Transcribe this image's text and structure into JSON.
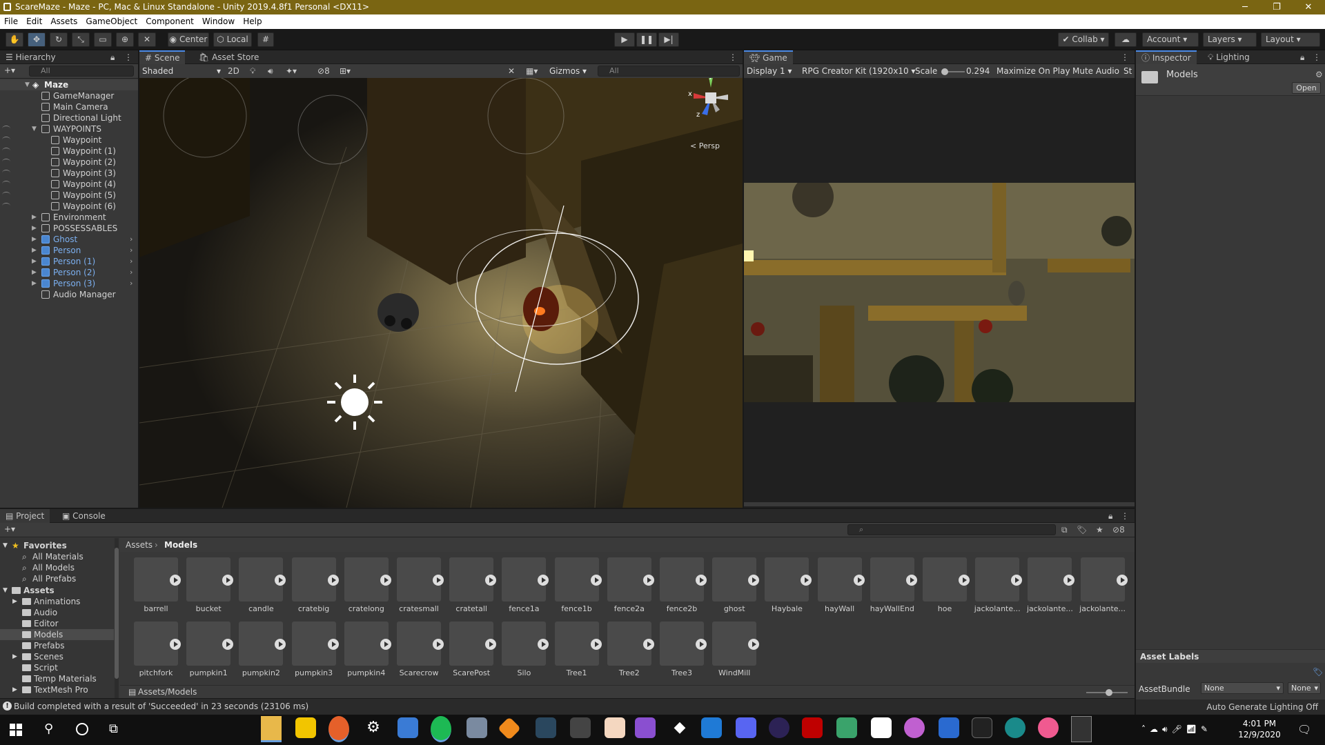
{
  "window": {
    "title": "ScareMaze - Maze - PC, Mac & Linux Standalone - Unity 2019.4.8f1 Personal <DX11>",
    "min": "─",
    "restore": "❐",
    "close": "✕"
  },
  "menu": [
    "File",
    "Edit",
    "Assets",
    "GameObject",
    "Component",
    "Window",
    "Help"
  ],
  "toolbar": {
    "pivot": "Center",
    "space": "Local",
    "collab": "Collab",
    "account": "Account",
    "layers": "Layers",
    "layout": "Layout"
  },
  "hierarchy": {
    "tab": "Hierarchy",
    "search_placeholder": "All",
    "scene": "Maze",
    "items": [
      {
        "label": "GameManager",
        "depth": 1,
        "blue": false,
        "arrow": ""
      },
      {
        "label": "Main Camera",
        "depth": 1,
        "blue": false,
        "arrow": ""
      },
      {
        "label": "Directional Light",
        "depth": 1,
        "blue": false,
        "arrow": ""
      },
      {
        "label": "WAYPOINTS",
        "depth": 1,
        "blue": false,
        "arrow": "▼"
      },
      {
        "label": "Waypoint",
        "depth": 2,
        "blue": false,
        "arrow": ""
      },
      {
        "label": "Waypoint (1)",
        "depth": 2,
        "blue": false,
        "arrow": ""
      },
      {
        "label": "Waypoint (2)",
        "depth": 2,
        "blue": false,
        "arrow": ""
      },
      {
        "label": "Waypoint (3)",
        "depth": 2,
        "blue": false,
        "arrow": ""
      },
      {
        "label": "Waypoint (4)",
        "depth": 2,
        "blue": false,
        "arrow": ""
      },
      {
        "label": "Waypoint (5)",
        "depth": 2,
        "blue": false,
        "arrow": ""
      },
      {
        "label": "Waypoint (6)",
        "depth": 2,
        "blue": false,
        "arrow": ""
      },
      {
        "label": "Environment",
        "depth": 1,
        "blue": false,
        "arrow": "▶"
      },
      {
        "label": "POSSESSABLES",
        "depth": 1,
        "blue": false,
        "arrow": "▶"
      },
      {
        "label": "Ghost",
        "depth": 1,
        "blue": true,
        "arrow": "▶"
      },
      {
        "label": "Person",
        "depth": 1,
        "blue": true,
        "arrow": "▶"
      },
      {
        "label": "Person (1)",
        "depth": 1,
        "blue": true,
        "arrow": "▶"
      },
      {
        "label": "Person (2)",
        "depth": 1,
        "blue": true,
        "arrow": "▶"
      },
      {
        "label": "Person (3)",
        "depth": 1,
        "blue": true,
        "arrow": "▶"
      },
      {
        "label": "Audio Manager",
        "depth": 1,
        "blue": false,
        "arrow": ""
      }
    ]
  },
  "scene": {
    "tab": "Scene",
    "tab2": "Asset Store",
    "shading": "Shaded",
    "mode2d": "2D",
    "hidden_count": "8",
    "gizmos": "Gizmos",
    "search_placeholder": "All",
    "persp": "< Persp",
    "axis_x": "x",
    "axis_y": "y",
    "axis_z": "z"
  },
  "game": {
    "tab": "Game",
    "display": "Display 1",
    "resolution": "RPG Creator Kit (1920x10",
    "scale_label": "Scale",
    "scale_value": "0.294",
    "maximize": "Maximize On Play",
    "mute": "Mute Audio",
    "stats": "St"
  },
  "inspector": {
    "tab": "Inspector",
    "tab2": "Lighting",
    "asset_name": "Models",
    "open_button": "Open",
    "asset_labels": "Asset Labels",
    "assetbundle_label": "AssetBundle",
    "assetbundle_value": "None",
    "variant_value": "None",
    "auto_lighting": "Auto Generate Lighting Off"
  },
  "project": {
    "tab": "Project",
    "tab2": "Console",
    "hidden_count": "8",
    "breadcrumb_root": "Assets",
    "breadcrumb_sep": "›",
    "breadcrumb_current": "Models",
    "footer_path": "Assets/Models",
    "favorites_label": "Favorites",
    "favorites": [
      "All Materials",
      "All Models",
      "All Prefabs"
    ],
    "assets_label": "Assets",
    "folders": [
      "Animations",
      "Audio",
      "Editor",
      "Models",
      "Prefabs",
      "Scenes",
      "Script",
      "Temp Materials",
      "TextMesh Pro"
    ],
    "row1": [
      "barrell",
      "bucket",
      "candle",
      "cratebig",
      "cratelong",
      "cratesmall",
      "cratetall",
      "fence1a",
      "fence1b",
      "fence2a",
      "fence2b",
      "ghost",
      "Haybale",
      "hayWall",
      "hayWallEnd",
      "hoe",
      "jackolante...",
      "jackolante...",
      "jackolante..."
    ],
    "row2": [
      "pitchfork",
      "pumpkin1",
      "pumpkin2",
      "pumpkin3",
      "pumpkin4",
      "Scarecrow",
      "ScarePost",
      "Silo",
      "Tree1",
      "Tree2",
      "Tree3",
      "WindMill"
    ]
  },
  "status": {
    "message": "Build completed with a result of 'Succeeded' in 23 seconds (23106 ms)"
  },
  "taskbar": {
    "time": "4:01 PM",
    "date": "12/9/2020"
  },
  "colors": {
    "titlebar": "#7a6512",
    "accent": "#4c8be8",
    "prefab_blue": "#7cb0f0",
    "panel": "#383838",
    "dark": "#191919"
  }
}
